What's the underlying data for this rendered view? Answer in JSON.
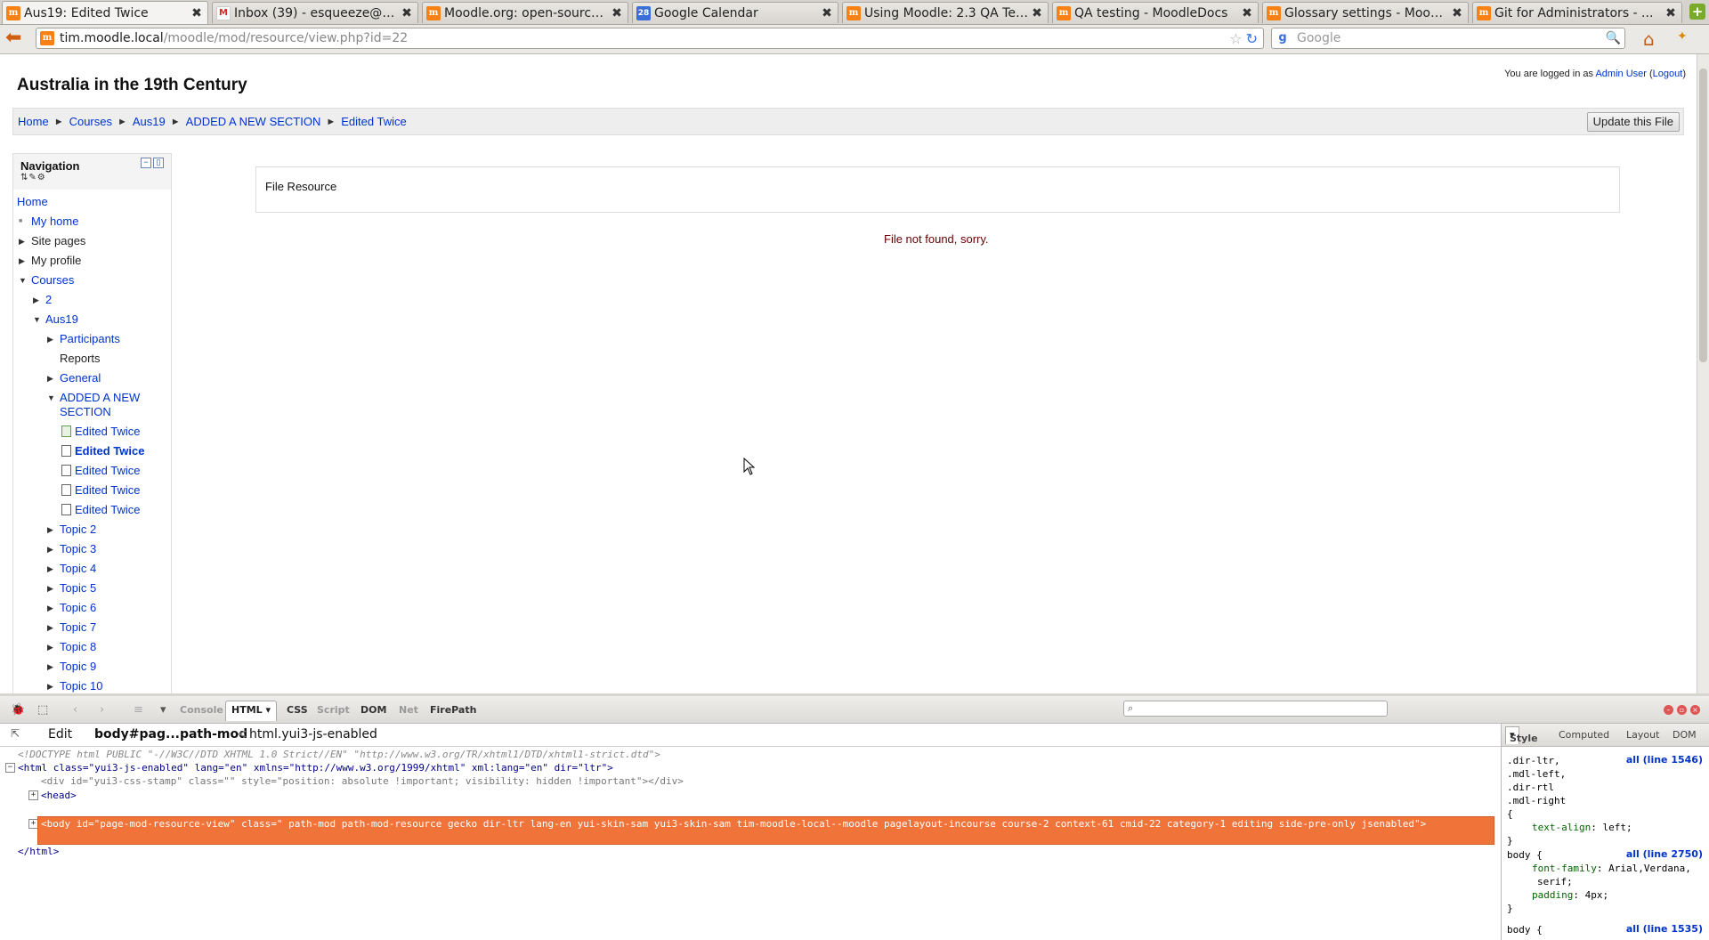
{
  "browser": {
    "tabs": [
      {
        "title": "Aus19: Edited Twice",
        "favicon": "moodle-icon",
        "active": true
      },
      {
        "title": "Inbox (39) - esqueeze@g...",
        "favicon": "gmail-icon",
        "active": false
      },
      {
        "title": "Moodle.org: open-source ...",
        "favicon": "moodle-icon",
        "active": false
      },
      {
        "title": "Google Calendar",
        "favicon": "calendar-icon",
        "active": false
      },
      {
        "title": "Using Moodle: 2.3 QA Tes...",
        "favicon": "moodle-icon",
        "active": false
      },
      {
        "title": "QA testing - MoodleDocs",
        "favicon": "moodle-icon",
        "active": false
      },
      {
        "title": "Glossary settings - Moodl...",
        "favicon": "moodle-icon",
        "active": false
      },
      {
        "title": "Git for Administrators - ...",
        "favicon": "moodle-icon",
        "active": false
      }
    ],
    "url_host": "tim.moodle.local",
    "url_path": "/moodle/mod/resource/view.php?id=22",
    "search_placeholder": "Google",
    "favicon_calendar_text": "28"
  },
  "header": {
    "site_title": "Australia in the 19th Century",
    "login_prefix": "You are logged in as ",
    "login_user": "Admin User",
    "logout_label": "Logout"
  },
  "breadcrumb": {
    "items": [
      "Home",
      "Courses",
      "Aus19",
      "ADDED A NEW SECTION",
      "Edited Twice"
    ],
    "separator": "►"
  },
  "update_button_label": "Update this File",
  "navigation": {
    "title": "Navigation",
    "home": "Home",
    "my_home": "My home",
    "site_pages": "Site pages",
    "my_profile": "My profile",
    "courses": "Courses",
    "course_2": "2",
    "course_aus19": "Aus19",
    "participants": "Participants",
    "reports": "Reports",
    "general": "General",
    "section_line1": "ADDED A NEW",
    "section_line2": "SECTION",
    "edited": [
      "Edited Twice",
      "Edited Twice",
      "Edited Twice",
      "Edited Twice",
      "Edited Twice"
    ],
    "topics": [
      "Topic 2",
      "Topic 3",
      "Topic 4",
      "Topic 5",
      "Topic 6",
      "Topic 7",
      "Topic 8",
      "Topic 9",
      "Topic 10"
    ]
  },
  "content": {
    "resource_heading": "File Resource",
    "error_message": "File not found, sorry."
  },
  "firebug": {
    "tabs": [
      "Console",
      "HTML",
      "CSS",
      "Script",
      "DOM",
      "Net",
      "FirePath"
    ],
    "active_tab": "HTML",
    "sub_edit": "Edit",
    "sub_crumb_1": "body#pag...path-mod",
    "sub_crumb_sep": "<",
    "sub_crumb_2": "html.yui3-js-enabled",
    "doctype": "<!DOCTYPE html PUBLIC \"-//W3C//DTD XHTML 1.0 Strict//EN\" \"http://www.w3.org/TR/xhtml1/DTD/xhtml1-strict.dtd\">",
    "html_open": "<html class=\"yui3-js-enabled\" lang=\"en\" xmlns=\"http://www.w3.org/1999/xhtml\" xml:lang=\"en\" dir=\"ltr\">",
    "stamp_div": "<div id=\"yui3-css-stamp\" class=\"\" style=\"position: absolute !important; visibility: hidden !important\"></div>",
    "head": "<head>",
    "body_tag": "<body id=\"page-mod-resource-view\" class=\" path-mod path-mod-resource gecko dir-ltr lang-en yui-skin-sam yui3-skin-sam tim-moodle-local--moodle pagelayout-incourse course-2 context-61 cmid-22 category-1 editing side-pre-only jsenabled\">",
    "html_close": "</html>",
    "side_tabs": [
      "Style",
      "Computed",
      "Layout",
      "DOM"
    ],
    "css_rule1_selector": ".dir-ltr,\n.mdl-left,\n.dir-rtl\n.mdl-right\n{",
    "css_rule1_prop": "text-align",
    "css_rule1_val": "left;",
    "css_rule1_src": "all (line 1546)",
    "css_rule2_selector": "body {",
    "css_rule2_prop1": "font-family",
    "css_rule2_val1": "Arial,Verdana,",
    "css_rule2_val1b": "serif;",
    "css_rule2_prop2": "padding",
    "css_rule2_val2": "4px;",
    "css_rule2_src": "all (line 2750)",
    "css_rule3_selector": "body {",
    "css_rule3_src": "all (line 1535)"
  },
  "colors": {
    "link": "#0033cc",
    "error": "#660000",
    "selection": "#f0733a"
  }
}
